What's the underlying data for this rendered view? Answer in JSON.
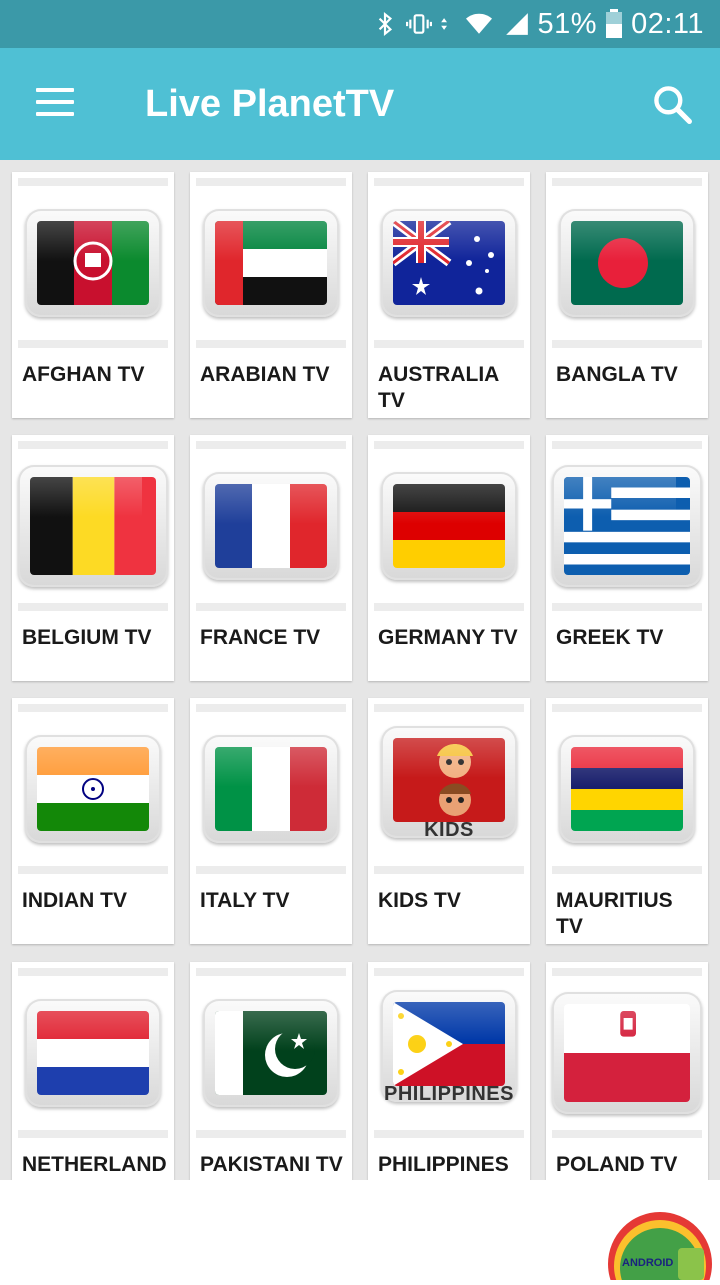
{
  "status_bar": {
    "battery_percent": "51%",
    "time": "02:11",
    "icons": [
      "bluetooth-icon",
      "vibrate-icon",
      "data-arrows-icon",
      "wifi-icon",
      "signal-icon",
      "battery-icon"
    ]
  },
  "app_bar": {
    "title": "Live PlanetTV",
    "menu_icon": "menu-icon",
    "search_icon": "search-icon"
  },
  "colors": {
    "status_bar": "#3b99a8",
    "app_bar": "#4fc0d4",
    "grid_background": "#e6e6e6",
    "card": "#ffffff"
  },
  "channels": [
    {
      "label": "AFGHAN TV",
      "flag": "afghanistan-flag"
    },
    {
      "label": "ARABIAN TV",
      "flag": "uae-flag"
    },
    {
      "label": "AUSTRALIA TV",
      "flag": "australia-flag"
    },
    {
      "label": "BANGLA TV",
      "flag": "bangladesh-flag"
    },
    {
      "label": "BELGIUM TV",
      "flag": "belgium-flag"
    },
    {
      "label": "FRANCE TV",
      "flag": "france-flag"
    },
    {
      "label": "GERMANY TV",
      "flag": "germany-flag"
    },
    {
      "label": "GREEK TV",
      "flag": "greece-flag"
    },
    {
      "label": "INDIAN TV",
      "flag": "india-flag"
    },
    {
      "label": "ITALY TV",
      "flag": "italy-flag"
    },
    {
      "label": "KIDS TV",
      "flag": "kids-image",
      "caption": "KIDS"
    },
    {
      "label": "MAURITIUS TV",
      "flag": "mauritius-flag"
    },
    {
      "label": "NETHERLAND",
      "flag": "netherlands-flag"
    },
    {
      "label": "PAKISTANI TV",
      "flag": "pakistan-flag"
    },
    {
      "label": "PHILIPPINES",
      "flag": "philippines-flag",
      "caption": "PHILIPPINES"
    },
    {
      "label": "POLAND TV",
      "flag": "poland-flag"
    }
  ],
  "watermark": {
    "icon": "android-logo-watermark",
    "text": "ANDROID"
  }
}
